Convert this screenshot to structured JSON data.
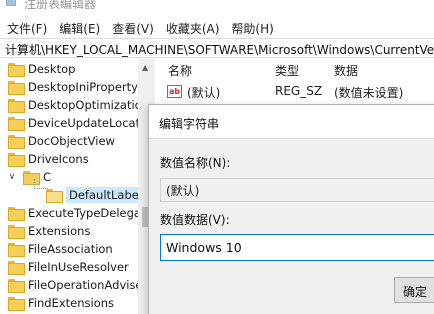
{
  "window": {
    "title": "注册表编辑器"
  },
  "menu": [
    "文件(F)",
    "编辑(E)",
    "查看(V)",
    "收藏夹(A)",
    "帮助(H)"
  ],
  "address": "计算机\\HKEY_LOCAL_MACHINE\\SOFTWARE\\Microsoft\\Windows\\CurrentVersion",
  "tree": {
    "items": [
      {
        "label": "Desktop"
      },
      {
        "label": "DesktopIniPropertyM"
      },
      {
        "label": "DesktopOptimization"
      },
      {
        "label": "DeviceUpdateLocatio"
      },
      {
        "label": "DocObjectView"
      },
      {
        "label": "DriveIcons"
      },
      {
        "label": "C",
        "expander": "∨"
      },
      {
        "label": "DefaultLabel"
      },
      {
        "label": "ExecuteTypeDelegate"
      },
      {
        "label": "Extensions"
      },
      {
        "label": "FileAssociation"
      },
      {
        "label": "FileInUseResolver"
      },
      {
        "label": "FileOperationAdviseS"
      },
      {
        "label": "FindExtensions"
      }
    ]
  },
  "list": {
    "headers": {
      "name": "名称",
      "type": "类型",
      "data": "数据"
    },
    "rows": [
      {
        "icon": "ab",
        "name": "(默认)",
        "type": "REG_SZ",
        "data": "(数值未设置)"
      }
    ]
  },
  "dialog": {
    "title": "编辑字符串",
    "name_label": "数值名称(N):",
    "name_value": "(默认)",
    "data_label": "数值数据(V):",
    "data_value": "Windows 10",
    "ok_label": "确定"
  }
}
